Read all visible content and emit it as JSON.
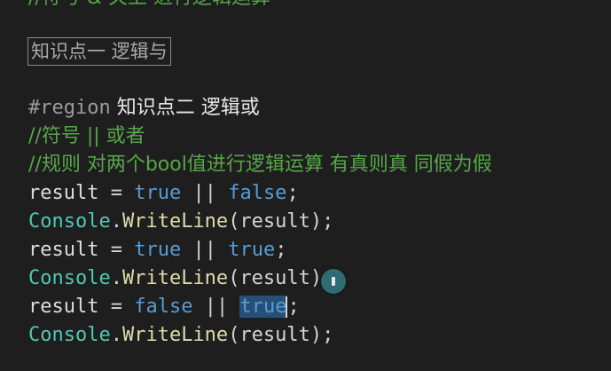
{
  "editor": {
    "top_partial_comment": "//符号 & 关上 进行逻辑运算",
    "collapsed_region_label": "知识点一 逻辑与",
    "region_directive": "#region",
    "region_title": " 知识点二 逻辑或",
    "comment_symbol": "//符号 || 或者",
    "comment_rule": "//规则 对两个bool值进行逻辑运算 有真则真 同假为假",
    "lines": [
      {
        "lhs": "result",
        "op": " = ",
        "left": "true",
        "or": " || ",
        "right": "false",
        "end": ";"
      },
      {
        "cls": "Console",
        "dot": ".",
        "method": "WriteLine",
        "args": "(result);"
      },
      {
        "lhs": "result",
        "op": " = ",
        "left": "true",
        "or": " || ",
        "right": "true",
        "end": ";"
      },
      {
        "cls": "Console",
        "dot": ".",
        "method": "WriteLine",
        "args_a": "(result)",
        "args_b": ";"
      },
      {
        "lhs": "result",
        "op": " = ",
        "left": "false",
        "or": " || ",
        "right_selected": "true",
        "end": ";"
      },
      {
        "cls": "Console",
        "dot": ".",
        "method": "WriteLine",
        "args": "(result);"
      }
    ]
  },
  "colors": {
    "background": "#1e1e1e",
    "comment": "#57a64a",
    "keyword": "#569cd6",
    "class": "#4ec9b0",
    "method": "#dcdcaa",
    "selection": "#264f78"
  },
  "icons": {
    "quick_action": "lightbulb-icon"
  }
}
